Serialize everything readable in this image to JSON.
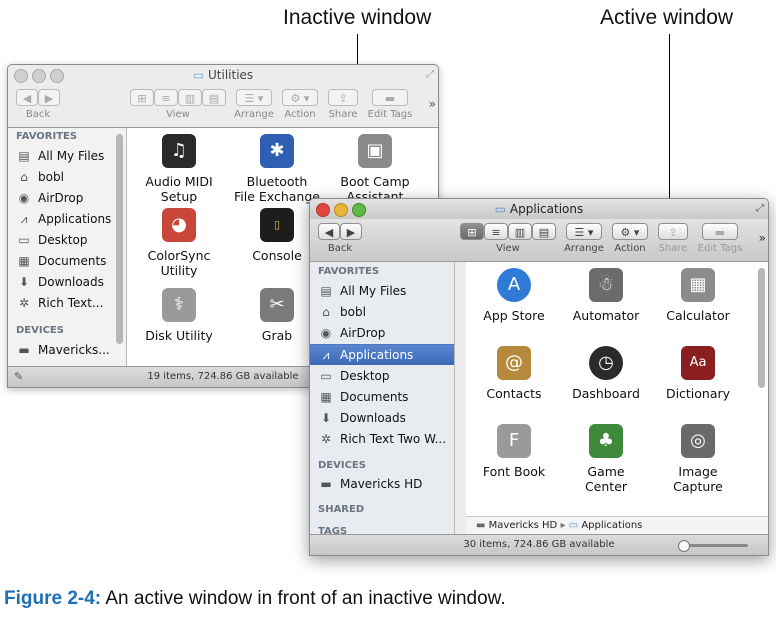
{
  "callouts": {
    "inactive": "Inactive window",
    "active": "Active window"
  },
  "caption": {
    "figure": "Figure 2-4:",
    "text": "An active window in front of an inactive window."
  },
  "toolbar_labels": {
    "back": "Back",
    "view": "View",
    "arrange": "Arrange",
    "action": "Action",
    "share": "Share",
    "edit_tags": "Edit Tags"
  },
  "inactive_window": {
    "title": "Utilities",
    "sidebar": {
      "favorites_header": "FAVORITES",
      "favorites": [
        {
          "label": "All My Files",
          "icon": "all-files-icon"
        },
        {
          "label": "bobl",
          "icon": "home-icon"
        },
        {
          "label": "AirDrop",
          "icon": "airdrop-icon"
        },
        {
          "label": "Applications",
          "icon": "applications-icon"
        },
        {
          "label": "Desktop",
          "icon": "desktop-icon"
        },
        {
          "label": "Documents",
          "icon": "documents-icon"
        },
        {
          "label": "Downloads",
          "icon": "downloads-icon"
        },
        {
          "label": "Rich Text...",
          "icon": "gear-icon"
        }
      ],
      "devices_header": "DEVICES",
      "devices": [
        {
          "label": "Mavericks...",
          "icon": "disk-icon"
        }
      ]
    },
    "items": [
      {
        "line1": "Audio MIDI",
        "line2": "Setup",
        "icon": "piano-icon",
        "color": "#2a2a2a"
      },
      {
        "line1": "Bluetooth",
        "line2": "File Exchange",
        "icon": "bluetooth-icon",
        "color": "#2f5fb3"
      },
      {
        "line1": "Boot Camp",
        "line2": "Assistant",
        "icon": "bootcamp-icon",
        "color": "#8a8a8a"
      },
      {
        "line1": "ColorSync",
        "line2": "Utility",
        "icon": "colorsync-icon",
        "color": "#c9473a"
      },
      {
        "line1": "Console",
        "line2": "",
        "icon": "console-icon",
        "color": "#1d1d1d"
      },
      {
        "line1": "Disk Utility",
        "line2": "",
        "icon": "disk-utility-icon",
        "color": "#9a9a9a"
      },
      {
        "line1": "Grab",
        "line2": "",
        "icon": "grab-icon",
        "color": "#7a7a7a"
      }
    ],
    "status": "19 items, 724.86 GB available"
  },
  "active_window": {
    "title": "Applications",
    "sidebar": {
      "favorites_header": "FAVORITES",
      "favorites": [
        {
          "label": "All My Files",
          "icon": "all-files-icon"
        },
        {
          "label": "bobl",
          "icon": "home-icon"
        },
        {
          "label": "AirDrop",
          "icon": "airdrop-icon"
        },
        {
          "label": "Applications",
          "icon": "applications-icon"
        },
        {
          "label": "Desktop",
          "icon": "desktop-icon"
        },
        {
          "label": "Documents",
          "icon": "documents-icon"
        },
        {
          "label": "Downloads",
          "icon": "downloads-icon"
        },
        {
          "label": "Rich Text Two W...",
          "icon": "gear-icon"
        }
      ],
      "devices_header": "DEVICES",
      "devices": [
        {
          "label": "Mavericks HD",
          "icon": "disk-icon"
        }
      ],
      "shared_header": "SHARED",
      "tags_header": "TAGS"
    },
    "items": [
      {
        "line1": "App Store",
        "line2": "",
        "icon": "app-store-icon",
        "color": "#2f7ad6"
      },
      {
        "line1": "Automator",
        "line2": "",
        "icon": "automator-icon",
        "color": "#6b6b6b"
      },
      {
        "line1": "Calculator",
        "line2": "",
        "icon": "calculator-icon",
        "color": "#8c8c8c"
      },
      {
        "line1": "Contacts",
        "line2": "",
        "icon": "contacts-icon",
        "color": "#b58a3c"
      },
      {
        "line1": "Dashboard",
        "line2": "",
        "icon": "dashboard-icon",
        "color": "#2b2b2b"
      },
      {
        "line1": "Dictionary",
        "line2": "",
        "icon": "dictionary-icon",
        "color": "#8b1e1e"
      },
      {
        "line1": "Font Book",
        "line2": "",
        "icon": "font-book-icon",
        "color": "#9a9a9a"
      },
      {
        "line1": "Game",
        "line2": "Center",
        "icon": "game-center-icon",
        "color": "#3f8a3a"
      },
      {
        "line1": "Image",
        "line2": "Capture",
        "icon": "image-capture-icon",
        "color": "#6a6a6a"
      }
    ],
    "path": {
      "disk": "Mavericks HD",
      "folder": "Applications"
    },
    "status": "30 items, 724.86 GB available"
  }
}
